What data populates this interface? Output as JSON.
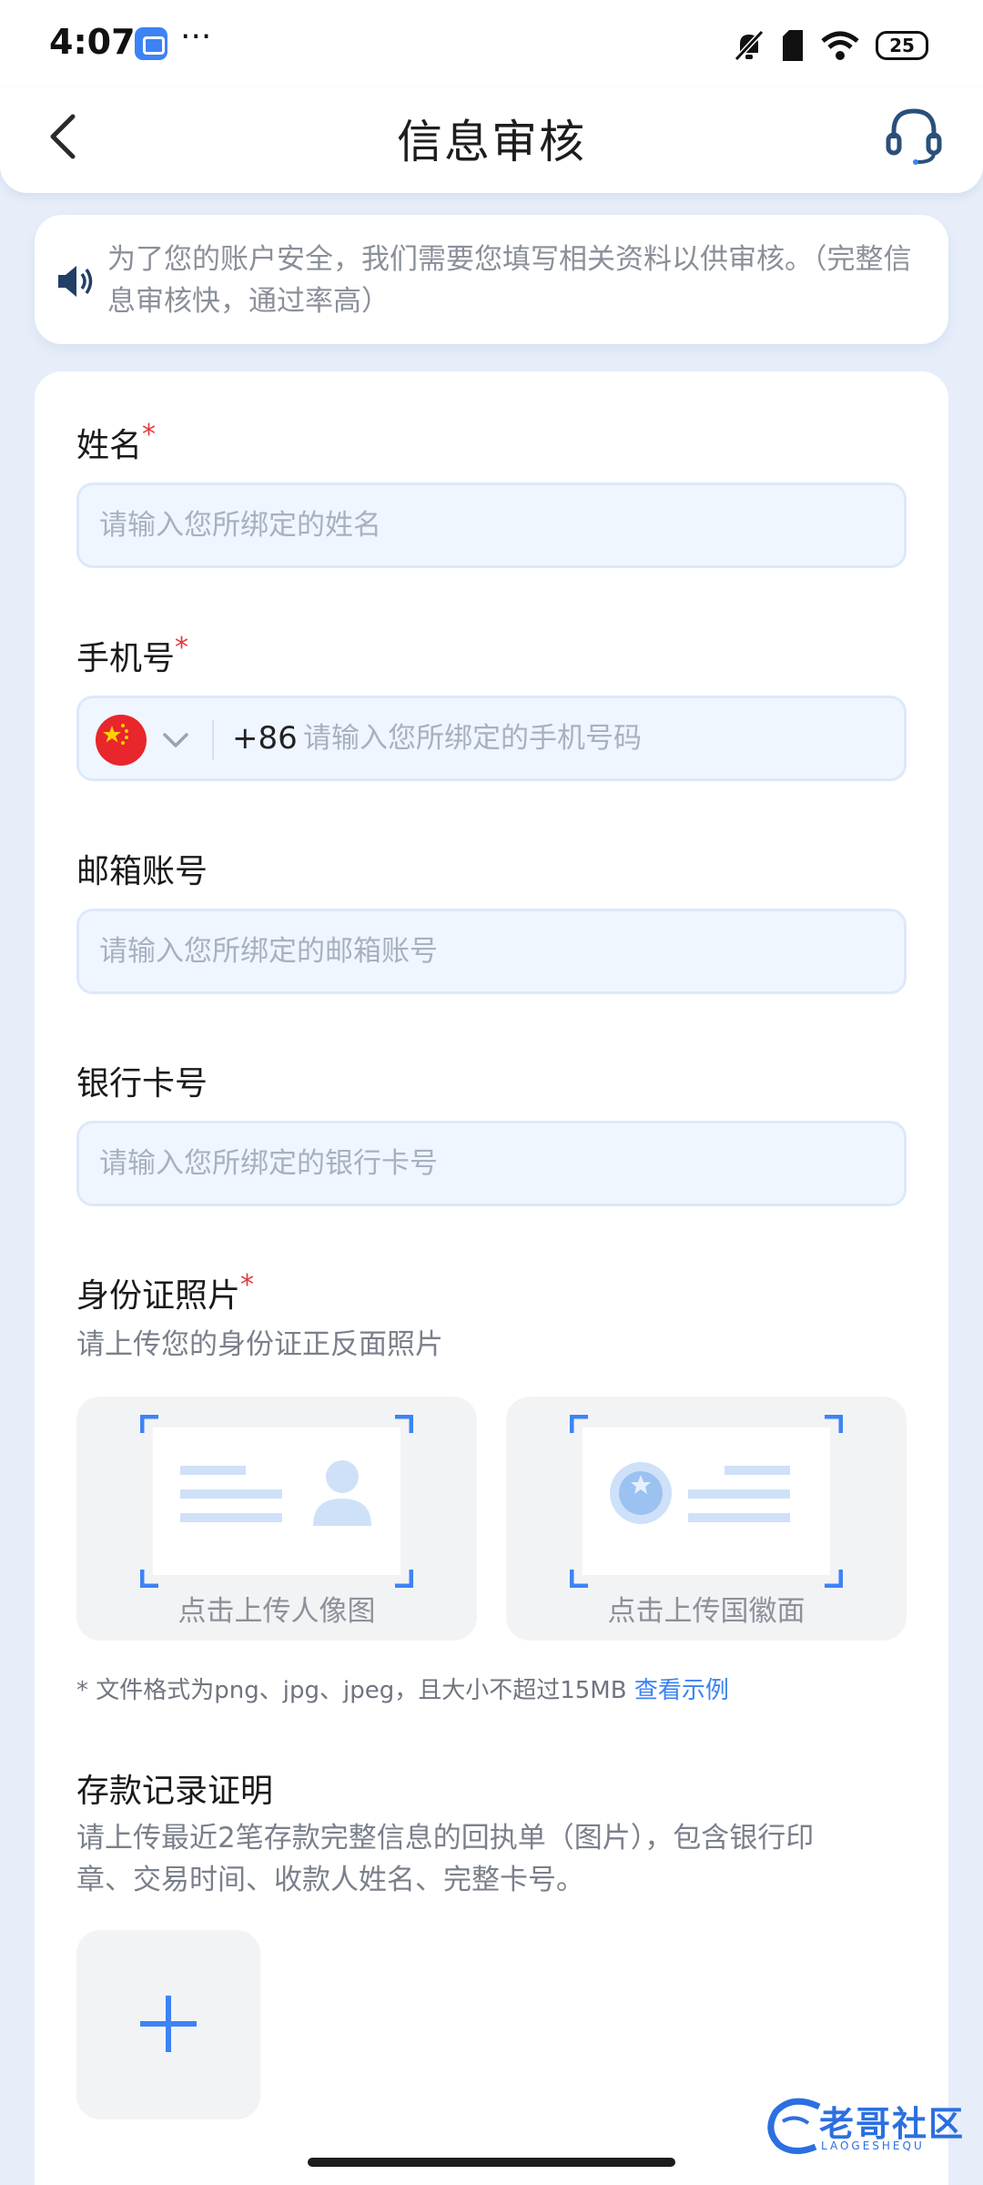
{
  "status_bar": {
    "time": "4:07",
    "dots": "···",
    "battery": "25"
  },
  "header": {
    "title": "信息审核"
  },
  "notice": {
    "text": "为了您的账户安全，我们需要您填写相关资料以供审核。（完整信息审核快，通过率高）"
  },
  "form": {
    "name": {
      "label": "姓名",
      "required_mark": "*",
      "placeholder": "请输入您所绑定的姓名"
    },
    "phone": {
      "label": "手机号",
      "required_mark": "*",
      "country_code": "+86",
      "placeholder": "请输入您所绑定的手机号码"
    },
    "email": {
      "label": "邮箱账号",
      "placeholder": "请输入您所绑定的邮箱账号"
    },
    "bank_card": {
      "label": "银行卡号",
      "placeholder": "请输入您所绑定的银行卡号"
    },
    "id_photo": {
      "label": "身份证照片",
      "required_mark": "*",
      "hint": "请上传您的身份证正反面照片",
      "front_label": "点击上传人像图",
      "back_label": "点击上传国徽面",
      "note": "* 文件格式为png、jpg、jpeg，且大小不超过15MB",
      "example_link": "查看示例"
    },
    "deposit": {
      "label": "存款记录证明",
      "hint_line1": "请上传最近2笔存款完整信息的回执单（图片），包含银行印",
      "hint_line2": "章、交易时间、收款人姓名、完整卡号。"
    }
  },
  "watermark": {
    "text": "老哥社区",
    "sub": "LAOGESHEQU"
  },
  "colors": {
    "accent": "#3b82f6",
    "required": "#e03a3a",
    "background": "#e7eef9"
  }
}
